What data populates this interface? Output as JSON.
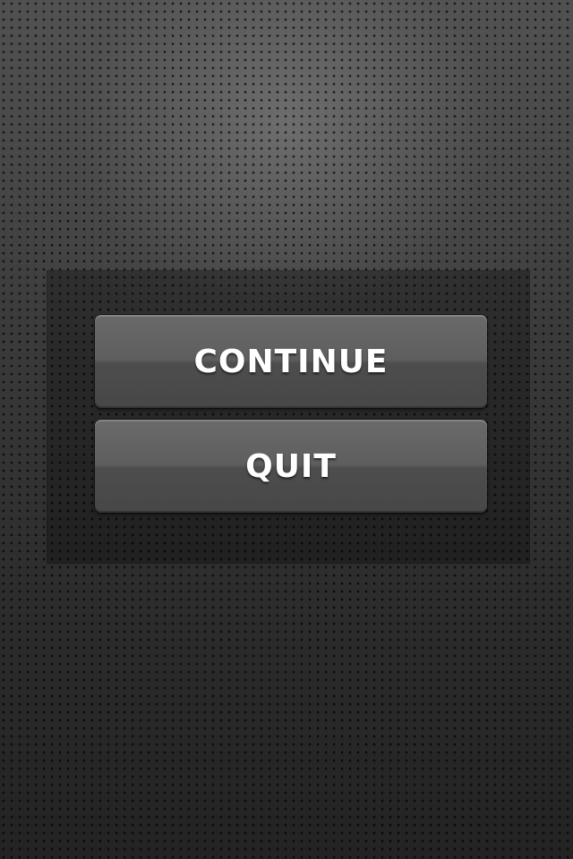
{
  "menu": {
    "continue_label": "CONTINUE",
    "quit_label": "QUIT"
  },
  "colors": {
    "background": "#3c3c3c",
    "button": "#5a5a5a",
    "text": "#ffffff"
  }
}
